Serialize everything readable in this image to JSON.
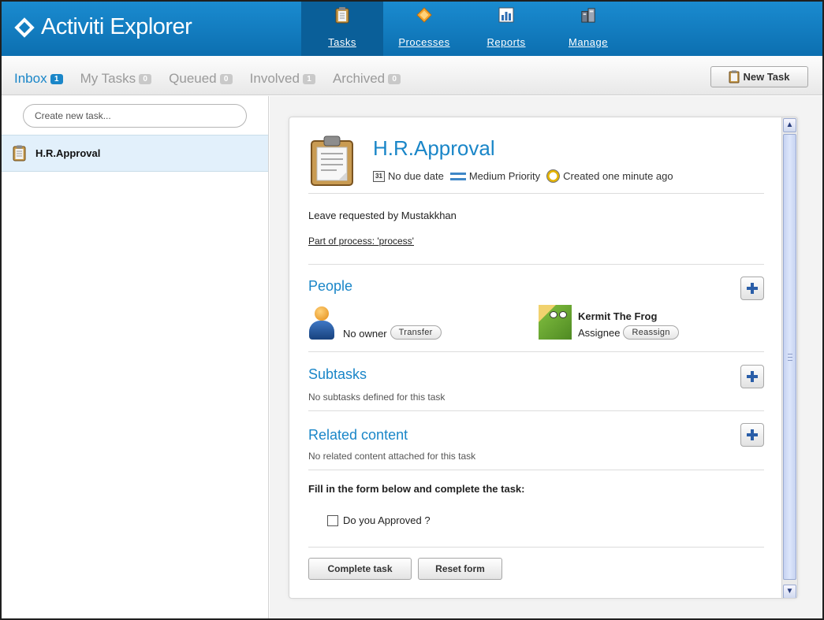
{
  "app": {
    "title": "Activiti Explorer"
  },
  "nav": [
    {
      "label": "Tasks",
      "icon": "clipboard-icon",
      "active": true
    },
    {
      "label": "Processes",
      "icon": "diamond-icon",
      "active": false
    },
    {
      "label": "Reports",
      "icon": "chart-icon",
      "active": false
    },
    {
      "label": "Manage",
      "icon": "cabinet-icon",
      "active": false
    }
  ],
  "tabs": [
    {
      "label": "Inbox",
      "count": "1",
      "active": true
    },
    {
      "label": "My Tasks",
      "count": "0",
      "active": false
    },
    {
      "label": "Queued",
      "count": "0",
      "active": false
    },
    {
      "label": "Involved",
      "count": "1",
      "active": false
    },
    {
      "label": "Archived",
      "count": "0",
      "active": false
    }
  ],
  "toolbar": {
    "new_task_label": "New Task"
  },
  "sidebar": {
    "create_placeholder": "Create new task...",
    "tasks": [
      {
        "label": "H.R.Approval",
        "selected": true
      }
    ]
  },
  "task": {
    "title": "H.R.Approval",
    "due_date": "No due date",
    "priority": "Medium Priority",
    "created": "Created one minute ago",
    "description": "Leave requested by Mustakkhan",
    "process_link": "Part of process: 'process'",
    "calendar_icon_text": "31"
  },
  "people": {
    "title": "People",
    "owner_text": "No owner",
    "transfer_label": "Transfer",
    "assignee_name": "Kermit The Frog",
    "assignee_role": "Assignee",
    "reassign_label": "Reassign"
  },
  "subtasks": {
    "title": "Subtasks",
    "note": "No subtasks defined for this task"
  },
  "related": {
    "title": "Related content",
    "note": "No related content attached for this task"
  },
  "form": {
    "title": "Fill in the form below and complete the task:",
    "checkbox_label": "Do you Approved ?",
    "complete_label": "Complete task",
    "reset_label": "Reset form"
  },
  "colors": {
    "header": "#1a8bd0",
    "accent": "#1a86c8",
    "selected_row": "#e2f0fb"
  }
}
